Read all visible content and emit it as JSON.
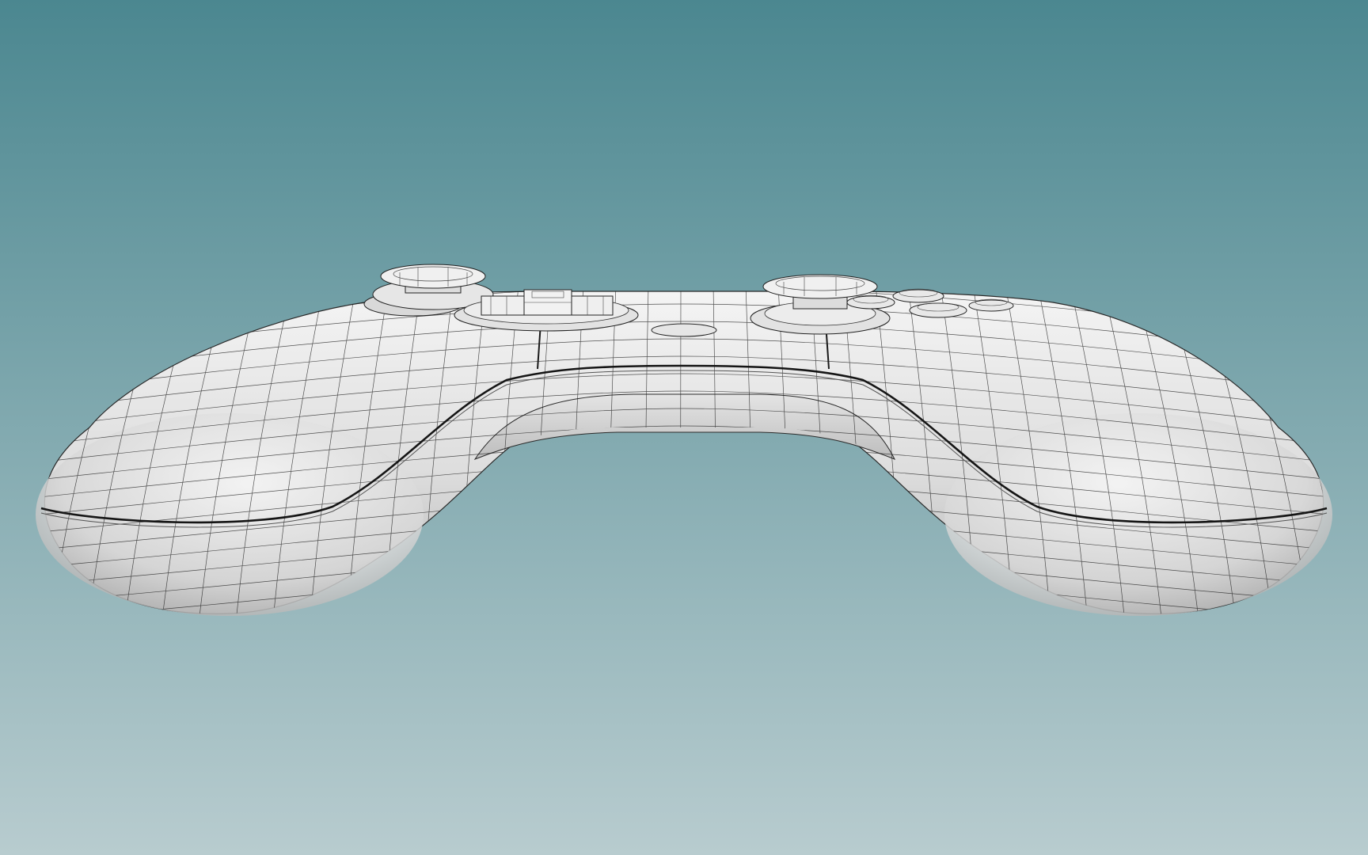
{
  "scene": {
    "subject": "gamepad-controller-wireframe",
    "background": {
      "top_color": "#4b8790",
      "bottom_color": "#b8cccf"
    },
    "shading": {
      "body_light": "#f2f2f2",
      "body_mid": "#cfcfcf",
      "body_shadow": "#8d8d8d",
      "wire_color": "#1c1c1c"
    }
  }
}
